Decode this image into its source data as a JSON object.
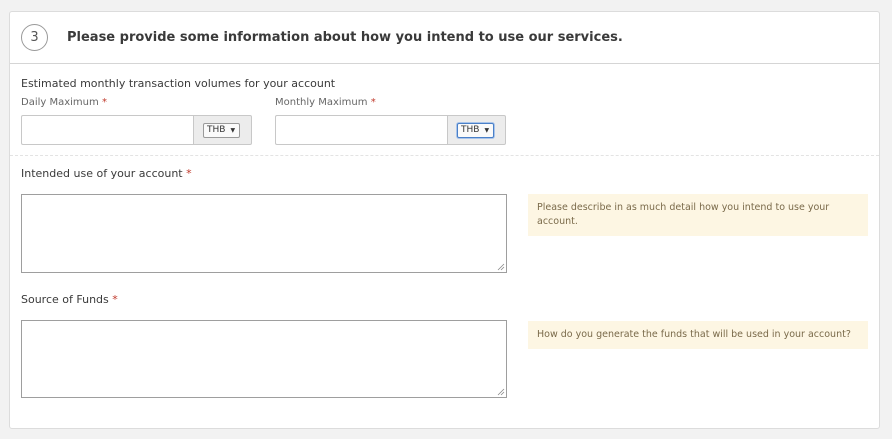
{
  "header": {
    "step_number": "3",
    "title": "Please provide some information about how you intend to use our services."
  },
  "volumes": {
    "section_label": "Estimated monthly transaction volumes for your account",
    "daily": {
      "label": "Daily Maximum",
      "required_mark": "*",
      "value": "",
      "currency": "THB"
    },
    "monthly": {
      "label": "Monthly Maximum",
      "required_mark": "*",
      "value": "",
      "currency": "THB"
    }
  },
  "intended_use": {
    "label": "Intended use of your account",
    "required_mark": "*",
    "value": "",
    "hint": "Please describe in as much detail how you intend to use your account."
  },
  "source_of_funds": {
    "label": "Source of Funds",
    "required_mark": "*",
    "value": "",
    "hint": "How do you generate the funds that will be used in your account?"
  },
  "icons": {
    "caret": "caret-down-icon",
    "resize": "resize-grip-icon"
  },
  "colors": {
    "required": "#c0392b",
    "hint_background": "#fdf6e3"
  }
}
